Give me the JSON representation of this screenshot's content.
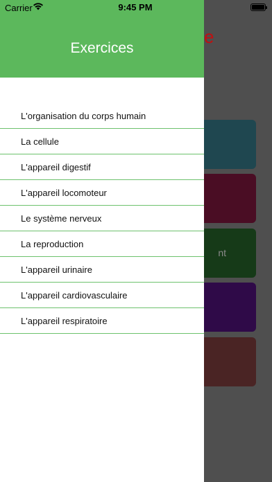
{
  "status_bar": {
    "carrier": "Carrier",
    "time": "9:45 PM",
    "wifi_icon": "wifi-icon",
    "battery_icon": "battery-icon"
  },
  "drawer": {
    "title": "Exercices",
    "header_color": "#5cb85c",
    "items": [
      {
        "label": "L'organisation du corps humain"
      },
      {
        "label": "La cellule"
      },
      {
        "label": "L'appareil digestif"
      },
      {
        "label": "L'appareil locomoteur"
      },
      {
        "label": "Le système nerveux"
      },
      {
        "label": "La reproduction"
      },
      {
        "label": "L'appareil urinaire"
      },
      {
        "label": "L'appareil cardiovasculaire"
      },
      {
        "label": "L'appareil respiratoire"
      }
    ]
  },
  "background": {
    "title_fragment": "e",
    "card_text_fragment": "nt",
    "card_colors": [
      "#1f4750",
      "#4a0d24",
      "#163a18",
      "#2f0a48",
      "#4a2424"
    ]
  }
}
